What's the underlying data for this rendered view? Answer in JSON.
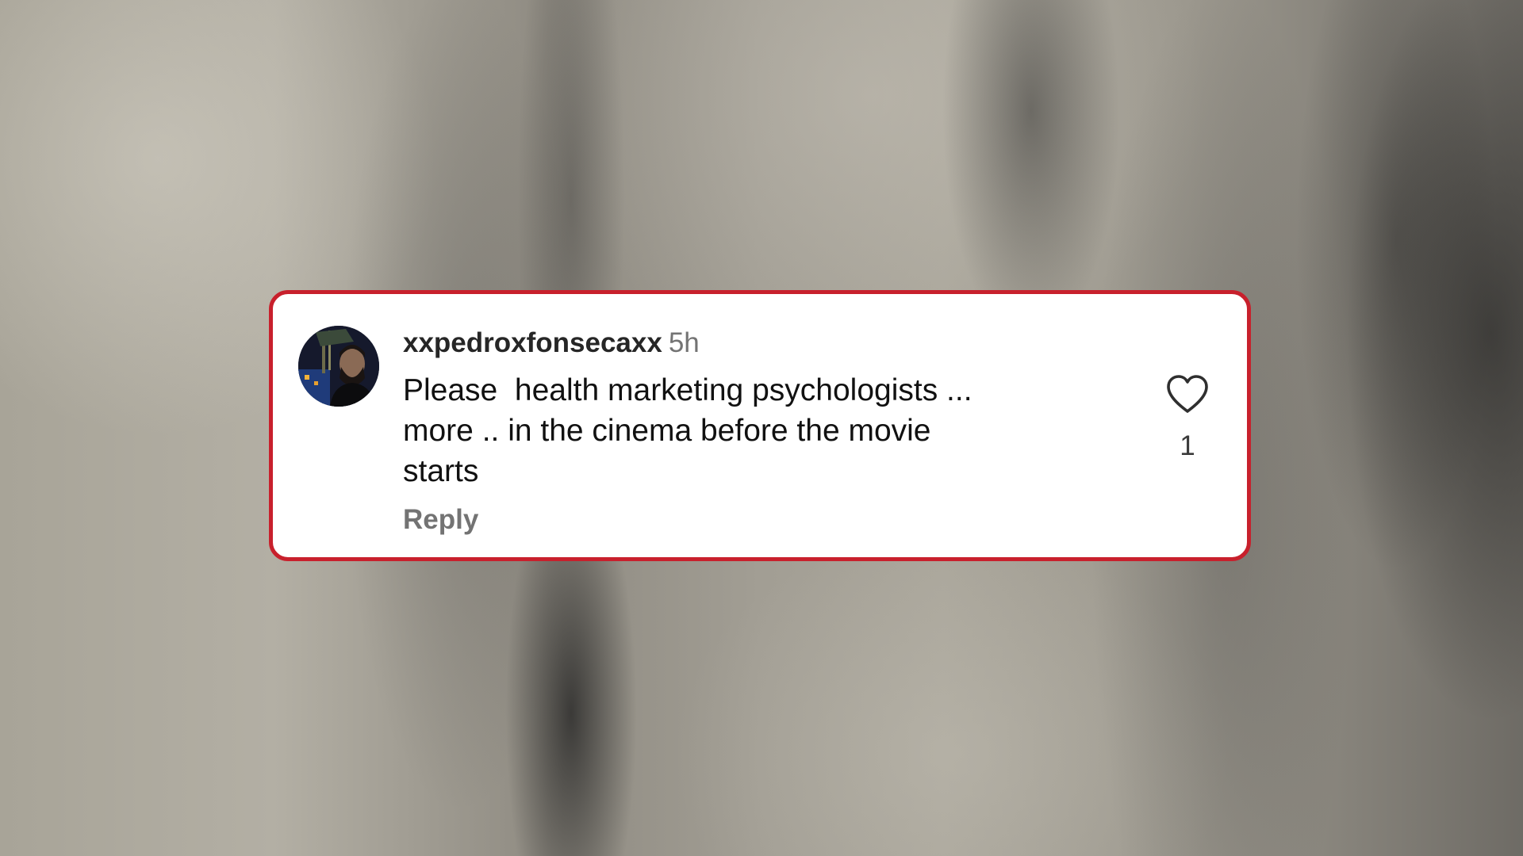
{
  "comment": {
    "username": "xxpedroxfonsecaxx",
    "timestamp": "5h",
    "text": "Please  health marketing psychologists ...\nmore .. in the cinema before the movie\nstarts",
    "reply_label": "Reply",
    "like_count": "1"
  },
  "icons": {
    "like": "heart-outline-icon",
    "avatar": "user-profile-photo"
  },
  "colors": {
    "card_border": "#c8202c",
    "card_background": "#ffffff",
    "username": "#262626",
    "secondary_text": "#737373"
  }
}
